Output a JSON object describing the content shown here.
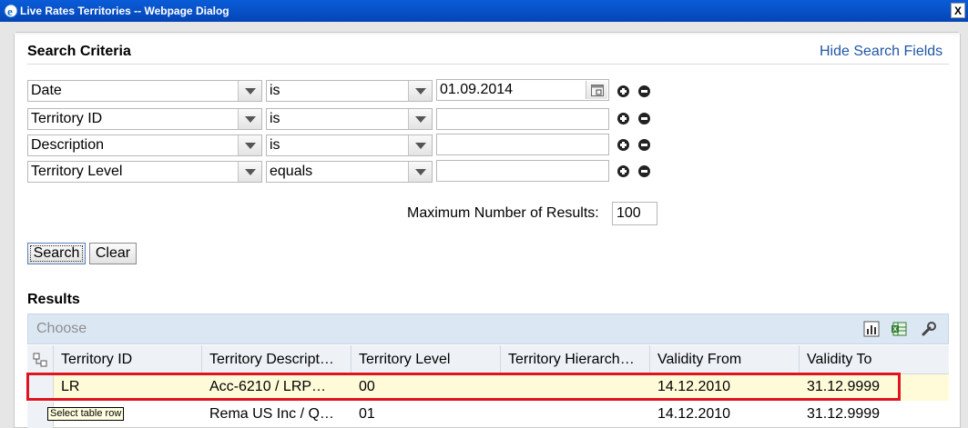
{
  "window": {
    "title": "Live Rates Territories -- Webpage Dialog",
    "close_label": "X"
  },
  "search": {
    "title": "Search Criteria",
    "hide_link": "Hide Search Fields",
    "rows": [
      {
        "field": "Date",
        "operator": "is",
        "value": "01.09.2014"
      },
      {
        "field": "Territory ID",
        "operator": "is",
        "value": ""
      },
      {
        "field": "Description",
        "operator": "is",
        "value": ""
      },
      {
        "field": "Territory Level",
        "operator": "equals",
        "value": ""
      }
    ],
    "max_results_label": "Maximum Number of Results:",
    "max_results_value": "100",
    "search_button": "Search",
    "clear_button": "Clear"
  },
  "results": {
    "title": "Results",
    "choose_label": "Choose",
    "columns": [
      "Territory ID",
      "Territory Descript…",
      "Territory Level",
      "Territory Hierarch…",
      "Validity From",
      "Validity To"
    ],
    "rows": [
      [
        "LR",
        "Acc-6210 / LRP…",
        "00",
        "",
        "14.12.2010",
        "31.12.9999"
      ],
      [
        "",
        "Rema US Inc / Q…",
        "01",
        "",
        "14.12.2010",
        "31.12.9999"
      ]
    ],
    "tooltip": "Select table row"
  },
  "icons": {
    "app": "ie-icon",
    "calendar": "calendar-icon",
    "add": "plus-circle-icon",
    "remove": "minus-circle-icon",
    "chart": "chart-icon",
    "export": "excel-export-icon",
    "settings": "wrench-icon",
    "column_select": "hierarchy-icon"
  },
  "colors": {
    "titlebar": "#0a5cd9",
    "link": "#2156a5",
    "selected_row": "#fffbd9",
    "highlight_box": "#e0141e",
    "toolbar": "#dce7f4"
  }
}
